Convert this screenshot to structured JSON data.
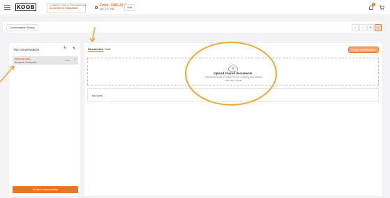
{
  "header": {
    "logo": "KOOB",
    "trip_label": "CURRENT TRIP IN TRIP DESIGNER",
    "trip_name": "ALVAREZ IN PANAMINO",
    "price_label": "From: 1565,42 €",
    "price_sub": "940,71 € / PAX",
    "edit_label": "Edit",
    "notification_count": "1"
  },
  "status_bar": {
    "button_label": "Conversation Status",
    "view_icons": [
      "list-view-icon",
      "calendar-view-icon",
      "settings-view-icon",
      "chat-view-icon"
    ]
  },
  "left_panel": {
    "title": "Trip conversations",
    "conversations": [
      {
        "status": "PENDING DMC",
        "desc": "Revoplus: Closing Ma...",
        "time": "Trans"
      }
    ],
    "new_button": "New conversation"
  },
  "right_panel": {
    "tabs": [
      "Documents",
      "Chat"
    ],
    "active_tab": "Documents",
    "close_button": "Close conversation",
    "upload_title": "Upload shared documents",
    "upload_desc": "Documents will be saved in the booking and shared with the Owner",
    "no_docs": "No docs"
  },
  "colors": {
    "accent": "#e8742a",
    "annotation": "#f0a830"
  }
}
